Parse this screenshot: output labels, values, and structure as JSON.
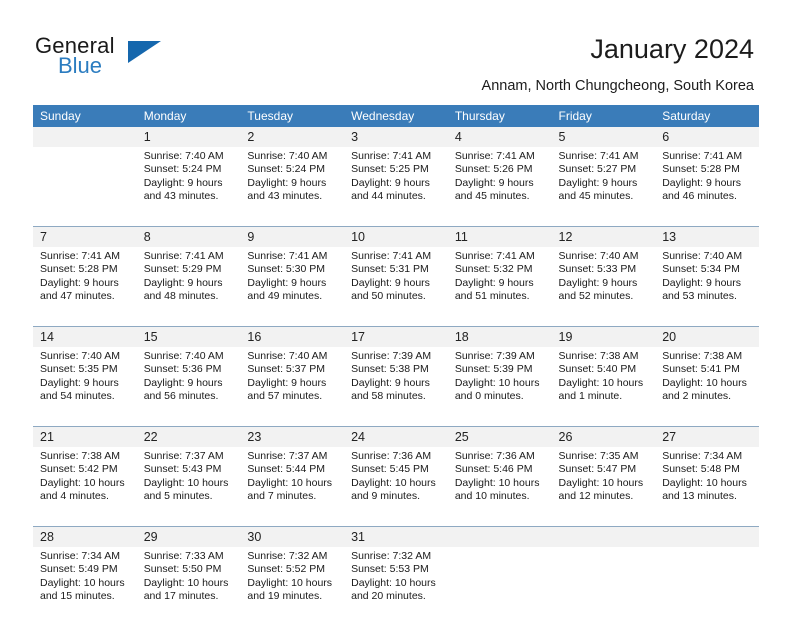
{
  "brand": {
    "name_part1": "General",
    "name_part2": "Blue"
  },
  "header": {
    "title": "January 2024",
    "subtitle": "Annam, North Chungcheong, South Korea"
  },
  "theme": {
    "header_blue": "#3a7cb9",
    "logo_blue": "#1567ad",
    "daynum_bg": "#f2f2f2",
    "separator": "#8ea9c2"
  },
  "weekday_headers": [
    "Sunday",
    "Monday",
    "Tuesday",
    "Wednesday",
    "Thursday",
    "Friday",
    "Saturday"
  ],
  "weeks": [
    {
      "days": [
        {
          "num": "",
          "sunrise": "",
          "sunset": "",
          "daylight1": "",
          "daylight2": ""
        },
        {
          "num": "1",
          "sunrise": "Sunrise: 7:40 AM",
          "sunset": "Sunset: 5:24 PM",
          "daylight1": "Daylight: 9 hours",
          "daylight2": "and 43 minutes."
        },
        {
          "num": "2",
          "sunrise": "Sunrise: 7:40 AM",
          "sunset": "Sunset: 5:24 PM",
          "daylight1": "Daylight: 9 hours",
          "daylight2": "and 43 minutes."
        },
        {
          "num": "3",
          "sunrise": "Sunrise: 7:41 AM",
          "sunset": "Sunset: 5:25 PM",
          "daylight1": "Daylight: 9 hours",
          "daylight2": "and 44 minutes."
        },
        {
          "num": "4",
          "sunrise": "Sunrise: 7:41 AM",
          "sunset": "Sunset: 5:26 PM",
          "daylight1": "Daylight: 9 hours",
          "daylight2": "and 45 minutes."
        },
        {
          "num": "5",
          "sunrise": "Sunrise: 7:41 AM",
          "sunset": "Sunset: 5:27 PM",
          "daylight1": "Daylight: 9 hours",
          "daylight2": "and 45 minutes."
        },
        {
          "num": "6",
          "sunrise": "Sunrise: 7:41 AM",
          "sunset": "Sunset: 5:28 PM",
          "daylight1": "Daylight: 9 hours",
          "daylight2": "and 46 minutes."
        }
      ]
    },
    {
      "days": [
        {
          "num": "7",
          "sunrise": "Sunrise: 7:41 AM",
          "sunset": "Sunset: 5:28 PM",
          "daylight1": "Daylight: 9 hours",
          "daylight2": "and 47 minutes."
        },
        {
          "num": "8",
          "sunrise": "Sunrise: 7:41 AM",
          "sunset": "Sunset: 5:29 PM",
          "daylight1": "Daylight: 9 hours",
          "daylight2": "and 48 minutes."
        },
        {
          "num": "9",
          "sunrise": "Sunrise: 7:41 AM",
          "sunset": "Sunset: 5:30 PM",
          "daylight1": "Daylight: 9 hours",
          "daylight2": "and 49 minutes."
        },
        {
          "num": "10",
          "sunrise": "Sunrise: 7:41 AM",
          "sunset": "Sunset: 5:31 PM",
          "daylight1": "Daylight: 9 hours",
          "daylight2": "and 50 minutes."
        },
        {
          "num": "11",
          "sunrise": "Sunrise: 7:41 AM",
          "sunset": "Sunset: 5:32 PM",
          "daylight1": "Daylight: 9 hours",
          "daylight2": "and 51 minutes."
        },
        {
          "num": "12",
          "sunrise": "Sunrise: 7:40 AM",
          "sunset": "Sunset: 5:33 PM",
          "daylight1": "Daylight: 9 hours",
          "daylight2": "and 52 minutes."
        },
        {
          "num": "13",
          "sunrise": "Sunrise: 7:40 AM",
          "sunset": "Sunset: 5:34 PM",
          "daylight1": "Daylight: 9 hours",
          "daylight2": "and 53 minutes."
        }
      ]
    },
    {
      "days": [
        {
          "num": "14",
          "sunrise": "Sunrise: 7:40 AM",
          "sunset": "Sunset: 5:35 PM",
          "daylight1": "Daylight: 9 hours",
          "daylight2": "and 54 minutes."
        },
        {
          "num": "15",
          "sunrise": "Sunrise: 7:40 AM",
          "sunset": "Sunset: 5:36 PM",
          "daylight1": "Daylight: 9 hours",
          "daylight2": "and 56 minutes."
        },
        {
          "num": "16",
          "sunrise": "Sunrise: 7:40 AM",
          "sunset": "Sunset: 5:37 PM",
          "daylight1": "Daylight: 9 hours",
          "daylight2": "and 57 minutes."
        },
        {
          "num": "17",
          "sunrise": "Sunrise: 7:39 AM",
          "sunset": "Sunset: 5:38 PM",
          "daylight1": "Daylight: 9 hours",
          "daylight2": "and 58 minutes."
        },
        {
          "num": "18",
          "sunrise": "Sunrise: 7:39 AM",
          "sunset": "Sunset: 5:39 PM",
          "daylight1": "Daylight: 10 hours",
          "daylight2": "and 0 minutes."
        },
        {
          "num": "19",
          "sunrise": "Sunrise: 7:38 AM",
          "sunset": "Sunset: 5:40 PM",
          "daylight1": "Daylight: 10 hours",
          "daylight2": "and 1 minute."
        },
        {
          "num": "20",
          "sunrise": "Sunrise: 7:38 AM",
          "sunset": "Sunset: 5:41 PM",
          "daylight1": "Daylight: 10 hours",
          "daylight2": "and 2 minutes."
        }
      ]
    },
    {
      "days": [
        {
          "num": "21",
          "sunrise": "Sunrise: 7:38 AM",
          "sunset": "Sunset: 5:42 PM",
          "daylight1": "Daylight: 10 hours",
          "daylight2": "and 4 minutes."
        },
        {
          "num": "22",
          "sunrise": "Sunrise: 7:37 AM",
          "sunset": "Sunset: 5:43 PM",
          "daylight1": "Daylight: 10 hours",
          "daylight2": "and 5 minutes."
        },
        {
          "num": "23",
          "sunrise": "Sunrise: 7:37 AM",
          "sunset": "Sunset: 5:44 PM",
          "daylight1": "Daylight: 10 hours",
          "daylight2": "and 7 minutes."
        },
        {
          "num": "24",
          "sunrise": "Sunrise: 7:36 AM",
          "sunset": "Sunset: 5:45 PM",
          "daylight1": "Daylight: 10 hours",
          "daylight2": "and 9 minutes."
        },
        {
          "num": "25",
          "sunrise": "Sunrise: 7:36 AM",
          "sunset": "Sunset: 5:46 PM",
          "daylight1": "Daylight: 10 hours",
          "daylight2": "and 10 minutes."
        },
        {
          "num": "26",
          "sunrise": "Sunrise: 7:35 AM",
          "sunset": "Sunset: 5:47 PM",
          "daylight1": "Daylight: 10 hours",
          "daylight2": "and 12 minutes."
        },
        {
          "num": "27",
          "sunrise": "Sunrise: 7:34 AM",
          "sunset": "Sunset: 5:48 PM",
          "daylight1": "Daylight: 10 hours",
          "daylight2": "and 13 minutes."
        }
      ]
    },
    {
      "days": [
        {
          "num": "28",
          "sunrise": "Sunrise: 7:34 AM",
          "sunset": "Sunset: 5:49 PM",
          "daylight1": "Daylight: 10 hours",
          "daylight2": "and 15 minutes."
        },
        {
          "num": "29",
          "sunrise": "Sunrise: 7:33 AM",
          "sunset": "Sunset: 5:50 PM",
          "daylight1": "Daylight: 10 hours",
          "daylight2": "and 17 minutes."
        },
        {
          "num": "30",
          "sunrise": "Sunrise: 7:32 AM",
          "sunset": "Sunset: 5:52 PM",
          "daylight1": "Daylight: 10 hours",
          "daylight2": "and 19 minutes."
        },
        {
          "num": "31",
          "sunrise": "Sunrise: 7:32 AM",
          "sunset": "Sunset: 5:53 PM",
          "daylight1": "Daylight: 10 hours",
          "daylight2": "and 20 minutes."
        },
        {
          "num": "",
          "sunrise": "",
          "sunset": "",
          "daylight1": "",
          "daylight2": ""
        },
        {
          "num": "",
          "sunrise": "",
          "sunset": "",
          "daylight1": "",
          "daylight2": ""
        },
        {
          "num": "",
          "sunrise": "",
          "sunset": "",
          "daylight1": "",
          "daylight2": ""
        }
      ]
    }
  ]
}
